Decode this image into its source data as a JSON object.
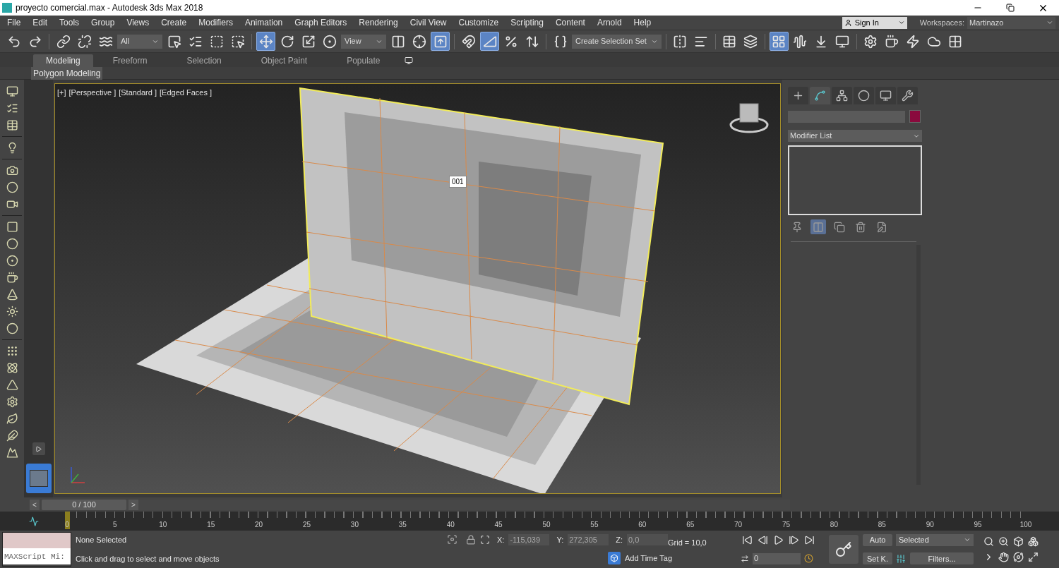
{
  "window": {
    "title": "proyecto comercial.max - Autodesk 3ds Max 2018"
  },
  "menu": [
    "File",
    "Edit",
    "Tools",
    "Group",
    "Views",
    "Create",
    "Modifiers",
    "Animation",
    "Graph Editors",
    "Rendering",
    "Civil View",
    "Customize",
    "Scripting",
    "Content",
    "Arnold",
    "Help"
  ],
  "account": {
    "sign_in": "Sign In",
    "workspaces_label": "Workspaces:",
    "workspace": "Martinazo"
  },
  "toolbar": [
    {
      "kind": "button",
      "selected": false
    },
    {
      "kind": "button",
      "selected": false
    },
    {
      "kind": "separator"
    },
    {
      "kind": "button",
      "selected": false
    },
    {
      "kind": "button",
      "selected": false
    },
    {
      "kind": "button",
      "selected": false
    },
    {
      "kind": "dropdown",
      "value": "All"
    },
    {
      "kind": "button",
      "selected": false
    },
    {
      "kind": "button",
      "selected": false
    },
    {
      "kind": "button",
      "selected": false
    },
    {
      "kind": "button",
      "selected": false
    },
    {
      "kind": "separator"
    },
    {
      "kind": "button",
      "selected": true
    },
    {
      "kind": "button",
      "selected": false
    },
    {
      "kind": "button",
      "selected": false
    },
    {
      "kind": "button",
      "selected": false
    },
    {
      "kind": "dropdown",
      "value": "View"
    },
    {
      "kind": "button",
      "selected": false
    },
    {
      "kind": "button",
      "selected": false
    },
    {
      "kind": "button",
      "selected": true
    },
    {
      "kind": "separator"
    },
    {
      "kind": "button",
      "selected": false
    },
    {
      "kind": "button",
      "selected": true
    },
    {
      "kind": "button",
      "selected": false
    },
    {
      "kind": "button",
      "selected": false
    },
    {
      "kind": "separator"
    },
    {
      "kind": "button",
      "selected": false
    },
    {
      "kind": "dropdown",
      "value": "Create Selection Set"
    },
    {
      "kind": "separator"
    },
    {
      "kind": "button",
      "selected": false
    },
    {
      "kind": "button",
      "selected": false
    },
    {
      "kind": "separator"
    },
    {
      "kind": "button",
      "selected": false
    },
    {
      "kind": "button",
      "selected": false
    },
    {
      "kind": "separator"
    },
    {
      "kind": "button",
      "selected": true
    },
    {
      "kind": "button",
      "selected": false
    },
    {
      "kind": "button",
      "selected": false
    },
    {
      "kind": "button",
      "selected": false
    },
    {
      "kind": "separator"
    },
    {
      "kind": "button",
      "selected": false
    },
    {
      "kind": "button",
      "selected": false
    },
    {
      "kind": "button",
      "selected": false
    },
    {
      "kind": "button",
      "selected": false
    },
    {
      "kind": "button",
      "selected": false
    }
  ],
  "ribbon": {
    "tabs": [
      {
        "label": "Modeling",
        "selected": true
      },
      {
        "label": "Freeform",
        "selected": false
      },
      {
        "label": "Selection",
        "selected": false
      },
      {
        "label": "Object Paint",
        "selected": false
      },
      {
        "label": "Populate",
        "selected": false
      }
    ],
    "panel": "Polygon Modeling"
  },
  "viewport": {
    "labels": [
      "[+]",
      "[Perspective ]",
      "[Standard ]",
      "[Edged Faces ]"
    ],
    "object_label": "001"
  },
  "command_panel": {
    "tabs": [
      {
        "selected": false
      },
      {
        "selected": true
      },
      {
        "selected": false
      },
      {
        "selected": false
      },
      {
        "selected": false
      },
      {
        "selected": false
      }
    ],
    "modifier_list": "Modifier List",
    "stack_buttons": [
      {
        "selected": false
      },
      {
        "selected": true
      },
      {
        "selected": false
      },
      {
        "selected": false
      },
      {
        "selected": false
      }
    ]
  },
  "time_slider": {
    "prev": "<",
    "next": ">",
    "position": "0 / 100",
    "level": 0
  },
  "track_bar": {
    "ticks": [
      "0",
      "5",
      "10",
      "15",
      "20",
      "25",
      "30",
      "35",
      "40",
      "45",
      "50",
      "55",
      "60",
      "65",
      "70",
      "75",
      "80",
      "85",
      "90",
      "95",
      "100"
    ]
  },
  "status": {
    "listener": "MAXScript Mi:",
    "selection": "None Selected",
    "prompt": "Click and drag to select and move objects",
    "coords": [
      {
        "axis": "X:",
        "value": "-115,039"
      },
      {
        "axis": "Y:",
        "value": "272,305"
      },
      {
        "axis": "Z:",
        "value": "0,0"
      }
    ],
    "grid": "Grid = 10,0",
    "time_tag": "Add Time Tag",
    "frame": "0",
    "auto_key": "Auto",
    "set_key": "Set K.",
    "key_mode": "Selected",
    "filters": "Filters..."
  }
}
